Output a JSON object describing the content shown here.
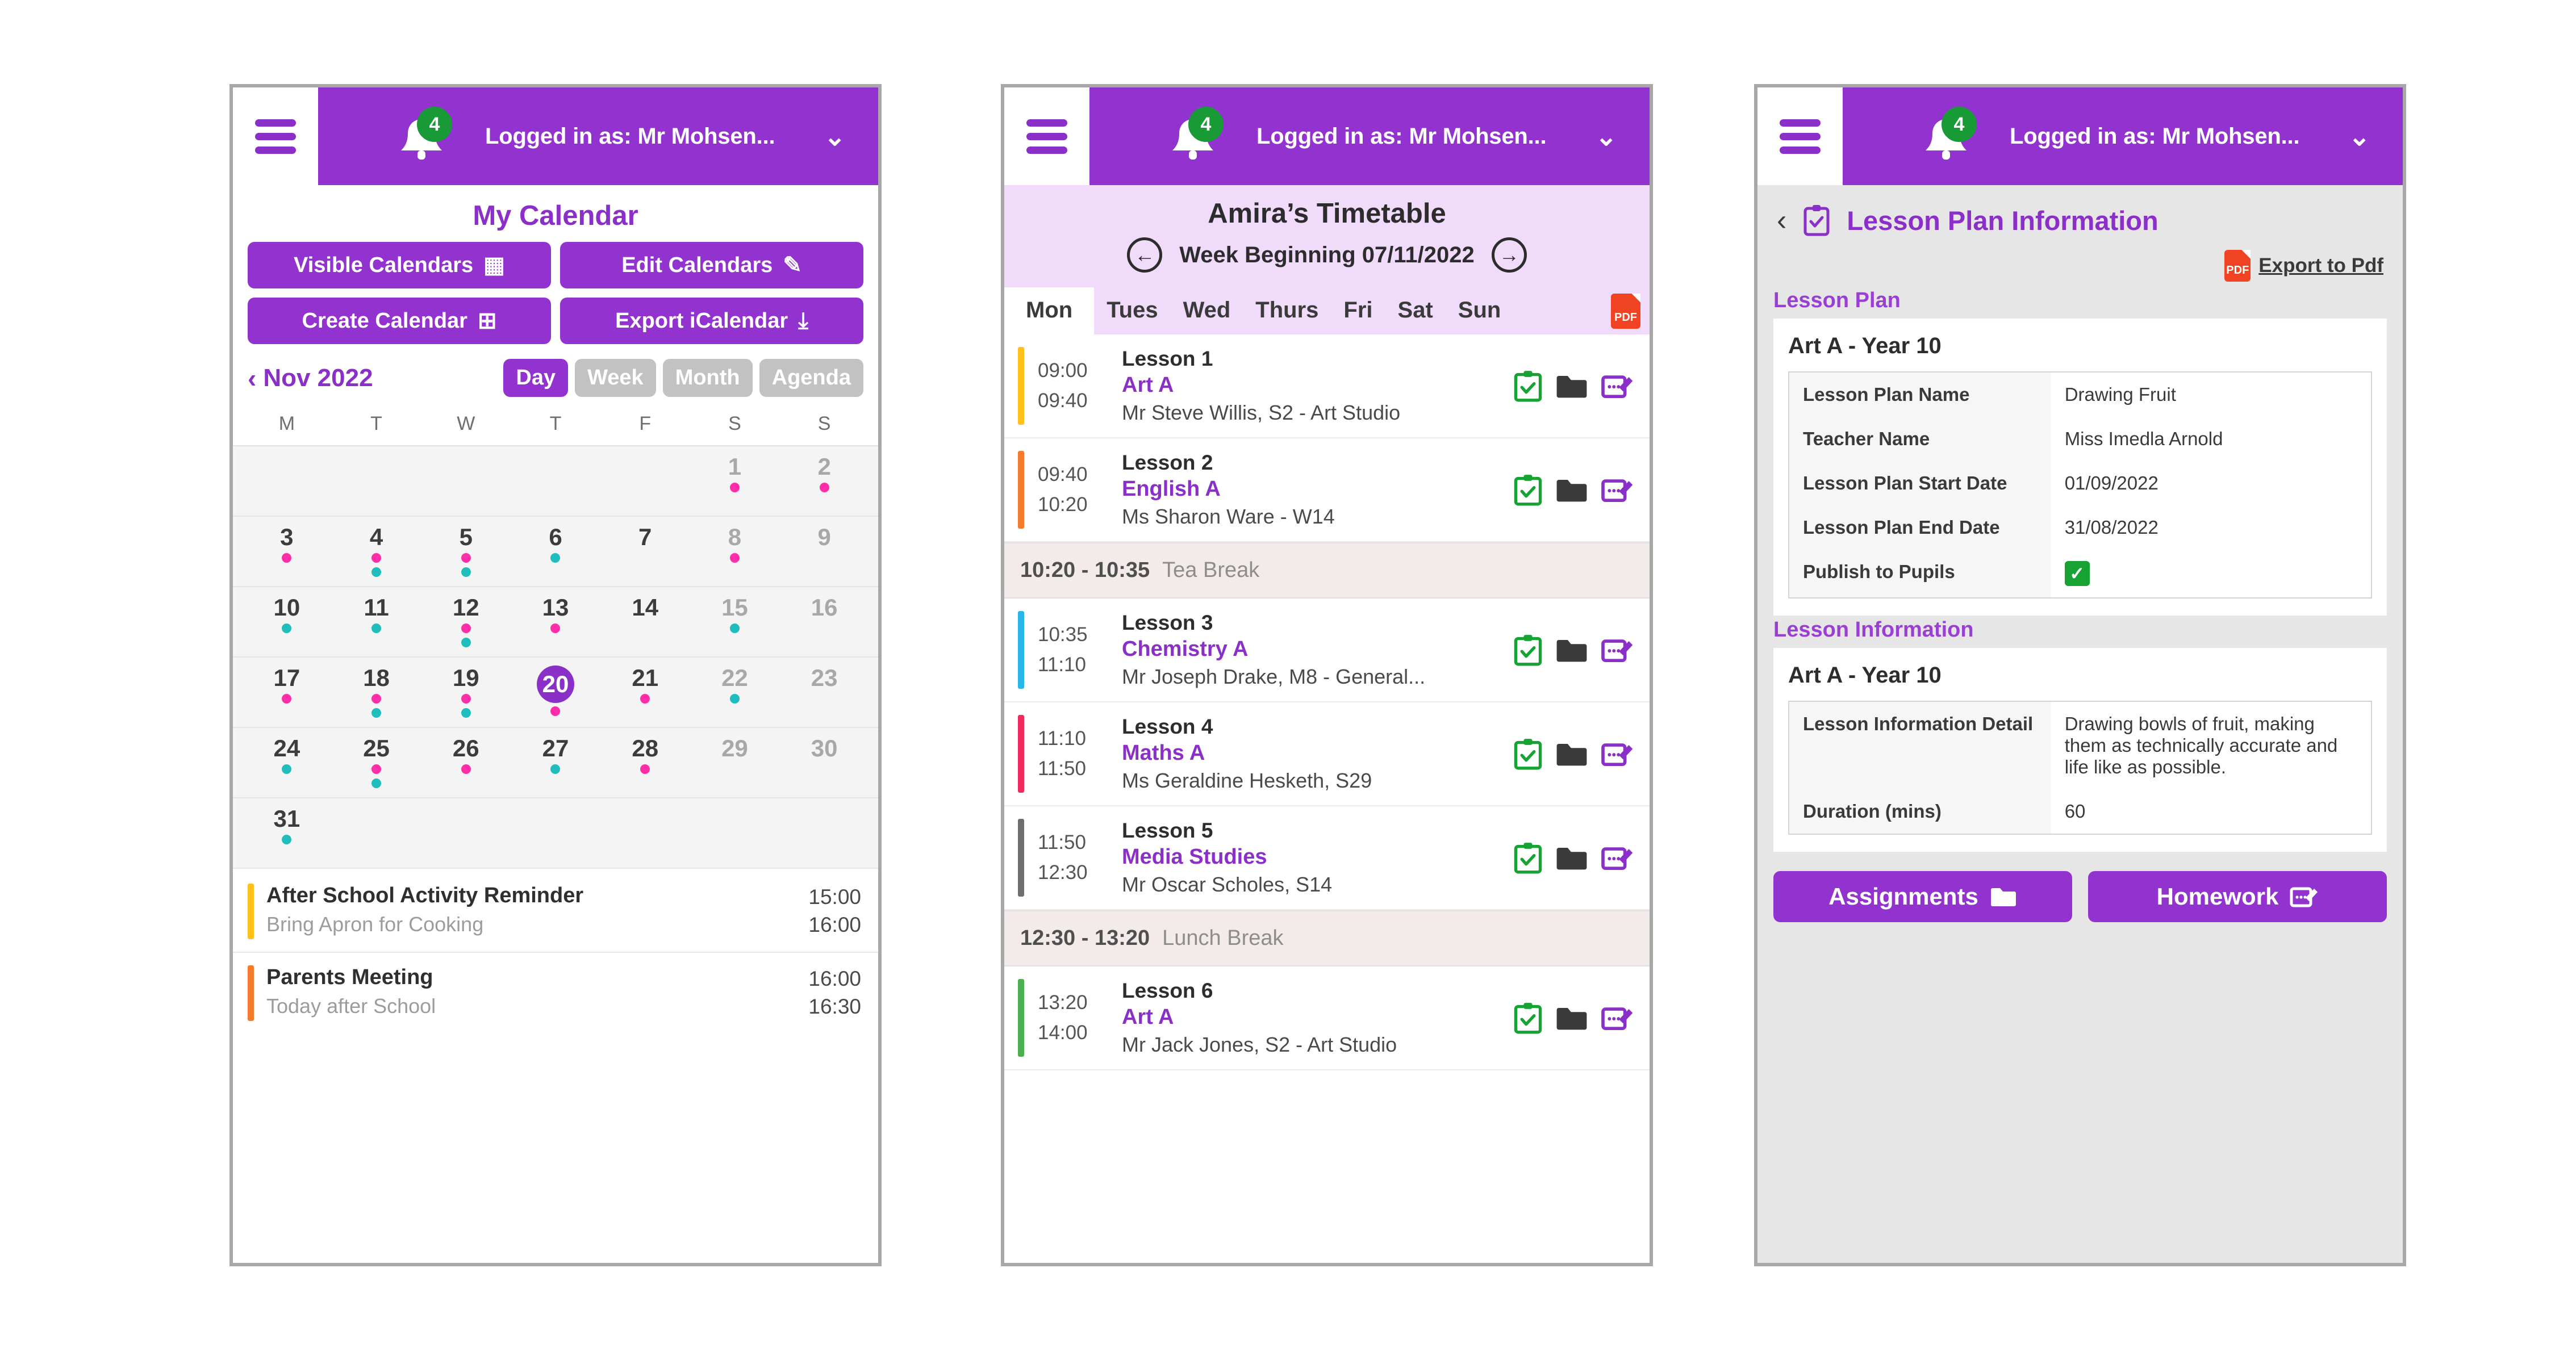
{
  "header": {
    "menu_icon": "hamburger-menu-icon",
    "bell_icon": "notification-bell-icon",
    "notification_count": "4",
    "logged_in_text": "Logged in as: Mr Mohsen...",
    "chevron": "⌄"
  },
  "calendar_panel": {
    "title": "My Calendar",
    "buttons": [
      {
        "label": "Visible Calendars",
        "icon": "calendar-grid-icon",
        "glyph": "▦"
      },
      {
        "label": "Edit Calendars",
        "icon": "edit-square-icon",
        "glyph": "✎"
      },
      {
        "label": "Create Calendar",
        "icon": "calendar-plus-icon",
        "glyph": "⊞"
      },
      {
        "label": "Export iCalendar",
        "icon": "calendar-download-icon",
        "glyph": "⤓"
      }
    ],
    "month_label": "Nov 2022",
    "prev_icon": "chevron-left-icon",
    "view_modes": [
      {
        "label": "Day",
        "active": true
      },
      {
        "label": "Week",
        "active": false
      },
      {
        "label": "Month",
        "active": false
      },
      {
        "label": "Agenda",
        "active": false
      }
    ],
    "day_headers": [
      "M",
      "T",
      "W",
      "T",
      "F",
      "S",
      "S"
    ],
    "weeks": [
      [
        {
          "day": "",
          "muted": false,
          "today": false,
          "dots": []
        },
        {
          "day": "",
          "muted": false,
          "today": false,
          "dots": []
        },
        {
          "day": "",
          "muted": false,
          "today": false,
          "dots": []
        },
        {
          "day": "",
          "muted": false,
          "today": false,
          "dots": []
        },
        {
          "day": "",
          "muted": false,
          "today": false,
          "dots": []
        },
        {
          "day": "1",
          "muted": true,
          "today": false,
          "dots": [
            "pink"
          ]
        },
        {
          "day": "2",
          "muted": true,
          "today": false,
          "dots": [
            "pink"
          ]
        }
      ],
      [
        {
          "day": "3",
          "muted": false,
          "today": false,
          "dots": [
            "pink"
          ]
        },
        {
          "day": "4",
          "muted": false,
          "today": false,
          "dots": [
            "pink",
            "teal"
          ]
        },
        {
          "day": "5",
          "muted": false,
          "today": false,
          "dots": [
            "pink",
            "teal"
          ]
        },
        {
          "day": "6",
          "muted": false,
          "today": false,
          "dots": [
            "teal"
          ]
        },
        {
          "day": "7",
          "muted": false,
          "today": false,
          "dots": []
        },
        {
          "day": "8",
          "muted": true,
          "today": false,
          "dots": [
            "pink"
          ]
        },
        {
          "day": "9",
          "muted": true,
          "today": false,
          "dots": []
        }
      ],
      [
        {
          "day": "10",
          "muted": false,
          "today": false,
          "dots": [
            "teal"
          ]
        },
        {
          "day": "11",
          "muted": false,
          "today": false,
          "dots": [
            "teal"
          ]
        },
        {
          "day": "12",
          "muted": false,
          "today": false,
          "dots": [
            "pink",
            "teal"
          ]
        },
        {
          "day": "13",
          "muted": false,
          "today": false,
          "dots": [
            "pink"
          ]
        },
        {
          "day": "14",
          "muted": false,
          "today": false,
          "dots": []
        },
        {
          "day": "15",
          "muted": true,
          "today": false,
          "dots": [
            "teal"
          ]
        },
        {
          "day": "16",
          "muted": true,
          "today": false,
          "dots": []
        }
      ],
      [
        {
          "day": "17",
          "muted": false,
          "today": false,
          "dots": [
            "pink"
          ]
        },
        {
          "day": "18",
          "muted": false,
          "today": false,
          "dots": [
            "pink",
            "teal"
          ]
        },
        {
          "day": "19",
          "muted": false,
          "today": false,
          "dots": [
            "pink",
            "teal"
          ]
        },
        {
          "day": "20",
          "muted": false,
          "today": true,
          "dots": [
            "pink"
          ]
        },
        {
          "day": "21",
          "muted": false,
          "today": false,
          "dots": [
            "pink"
          ]
        },
        {
          "day": "22",
          "muted": true,
          "today": false,
          "dots": [
            "teal"
          ]
        },
        {
          "day": "23",
          "muted": true,
          "today": false,
          "dots": []
        }
      ],
      [
        {
          "day": "24",
          "muted": false,
          "today": false,
          "dots": [
            "teal"
          ]
        },
        {
          "day": "25",
          "muted": false,
          "today": false,
          "dots": [
            "pink",
            "teal"
          ]
        },
        {
          "day": "26",
          "muted": false,
          "today": false,
          "dots": [
            "pink"
          ]
        },
        {
          "day": "27",
          "muted": false,
          "today": false,
          "dots": [
            "teal"
          ]
        },
        {
          "day": "28",
          "muted": false,
          "today": false,
          "dots": [
            "pink"
          ]
        },
        {
          "day": "29",
          "muted": true,
          "today": false,
          "dots": []
        },
        {
          "day": "30",
          "muted": true,
          "today": false,
          "dots": []
        }
      ],
      [
        {
          "day": "31",
          "muted": false,
          "today": false,
          "dots": [
            "teal"
          ]
        },
        {
          "day": "",
          "muted": false,
          "today": false,
          "dots": []
        },
        {
          "day": "",
          "muted": false,
          "today": false,
          "dots": []
        },
        {
          "day": "",
          "muted": false,
          "today": false,
          "dots": []
        },
        {
          "day": "",
          "muted": false,
          "today": false,
          "dots": []
        },
        {
          "day": "",
          "muted": false,
          "today": false,
          "dots": []
        },
        {
          "day": "",
          "muted": false,
          "today": false,
          "dots": []
        }
      ]
    ],
    "events": [
      {
        "title": "After School Activity Reminder",
        "subtitle": "Bring Apron for Cooking",
        "start": "15:00",
        "end": "16:00",
        "color": "#ffc119"
      },
      {
        "title": "Parents Meeting",
        "subtitle": "Today after School",
        "start": "16:00",
        "end": "16:30",
        "color": "#f47b2a"
      }
    ]
  },
  "timetable_panel": {
    "title": "Amira’s Timetable",
    "week_label": "Week Beginning 07/11/2022",
    "prev_icon": "circle-arrow-left-icon",
    "next_icon": "circle-arrow-right-icon",
    "prev_glyph": "←",
    "next_glyph": "→",
    "day_tabs": [
      {
        "label": "Mon",
        "active": true
      },
      {
        "label": "Tues",
        "active": false
      },
      {
        "label": "Wed",
        "active": false
      },
      {
        "label": "Thurs",
        "active": false
      },
      {
        "label": "Fri",
        "active": false
      },
      {
        "label": "Sat",
        "active": false
      },
      {
        "label": "Sun",
        "active": false
      }
    ],
    "pdf_icon_label": "PDF",
    "rows": [
      {
        "type": "lesson",
        "start": "09:00",
        "end": "09:40",
        "name": "Lesson 1",
        "subject": "Art A",
        "teacher": "Mr Steve Willis, S2 - Art Studio",
        "color": "#ffc119"
      },
      {
        "type": "lesson",
        "start": "09:40",
        "end": "10:20",
        "name": "Lesson 2",
        "subject": "English A",
        "teacher": "Ms Sharon Ware - W14",
        "color": "#f47b2a"
      },
      {
        "type": "break",
        "time": "10:20 - 10:35",
        "name": "Tea Break"
      },
      {
        "type": "lesson",
        "start": "10:35",
        "end": "11:10",
        "name": "Lesson 3",
        "subject": "Chemistry A",
        "teacher": "Mr Joseph Drake, M8 - General...",
        "color": "#29b6e8"
      },
      {
        "type": "lesson",
        "start": "11:10",
        "end": "11:50",
        "name": "Lesson 4",
        "subject": "Maths A",
        "teacher": "Ms Geraldine Hesketh, S29",
        "color": "#ef2a5c"
      },
      {
        "type": "lesson",
        "start": "11:50",
        "end": "12:30",
        "name": "Lesson 5",
        "subject": "Media Studies",
        "teacher": "Mr Oscar Scholes, S14",
        "color": "#6e6e6e"
      },
      {
        "type": "break",
        "time": "12:30 - 13:20",
        "name": "Lunch Break"
      },
      {
        "type": "lesson",
        "start": "13:20",
        "end": "14:00",
        "name": "Lesson 6",
        "subject": "Art A",
        "teacher": "Mr Jack Jones, S2 - Art Studio",
        "color": "#4caf50"
      }
    ],
    "row_icons": [
      {
        "name": "lesson-plan-clipboard-icon"
      },
      {
        "name": "assignments-folder-icon"
      },
      {
        "name": "homework-edit-icon"
      }
    ]
  },
  "lessonplan_panel": {
    "back_icon": "chevron-left-icon",
    "back_glyph": "‹",
    "header_icon": "clipboard-check-icon",
    "title": "Lesson Plan Information",
    "export_label": "Export to Pdf",
    "export_icon": "pdf-file-icon",
    "sections": [
      {
        "label": "Lesson Plan",
        "card_title": "Art  A - Year 10",
        "rows": [
          {
            "key": "Lesson Plan Name",
            "value": "Drawing Fruit",
            "type": "text"
          },
          {
            "key": "Teacher Name",
            "value": "Miss Imedla Arnold",
            "type": "text"
          },
          {
            "key": "Lesson Plan Start Date",
            "value": "01/09/2022",
            "type": "text"
          },
          {
            "key": "Lesson Plan End Date",
            "value": "31/08/2022",
            "type": "text"
          },
          {
            "key": "Publish to Pupils",
            "value": "✓",
            "type": "check"
          }
        ]
      },
      {
        "label": "Lesson Information",
        "card_title": "Art  A - Year 10",
        "rows": [
          {
            "key": "Lesson Information Detail",
            "value": "Drawing bowls of fruit, making them as technically accurate and life like as possible.",
            "type": "text"
          },
          {
            "key": "Duration (mins)",
            "value": "60",
            "type": "text"
          }
        ]
      }
    ],
    "buttons": [
      {
        "label": "Assignments",
        "icon": "folder-icon"
      },
      {
        "label": "Homework",
        "icon": "edit-note-icon"
      }
    ]
  },
  "colors": {
    "brand_purple": "#9333cf",
    "brand_purple_text": "#8b2fc9",
    "badge_green": "#189a36",
    "dot_pink": "#ff2ea8",
    "dot_teal": "#20bdbd",
    "pdf_red": "#ef4323"
  }
}
